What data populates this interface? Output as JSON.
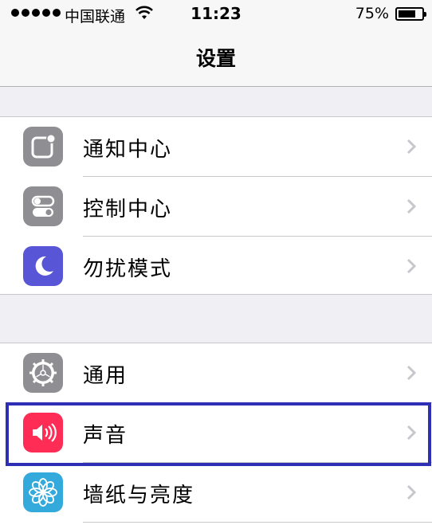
{
  "status_bar": {
    "carrier": "中国联通",
    "time": "11:23",
    "battery_percent": "75%",
    "battery_level": 0.75,
    "signal_bars": 5
  },
  "nav": {
    "title": "设置"
  },
  "groups": [
    {
      "items": [
        {
          "label": "通知中心",
          "icon": "notification-center-icon",
          "icon_color": "#8e8e93"
        },
        {
          "label": "控制中心",
          "icon": "control-center-icon",
          "icon_color": "#8e8e93"
        },
        {
          "label": "勿扰模式",
          "icon": "do-not-disturb-moon-icon",
          "icon_color": "#5856d6"
        }
      ]
    },
    {
      "items": [
        {
          "label": "通用",
          "icon": "general-gear-icon",
          "icon_color": "#8e8e93"
        },
        {
          "label": "声音",
          "icon": "sounds-speaker-icon",
          "icon_color": "#ff2d55",
          "highlighted": true
        },
        {
          "label": "墙纸与亮度",
          "icon": "wallpaper-flower-icon",
          "icon_color": "#34aadc"
        }
      ]
    }
  ],
  "colors": {
    "background": "#efeff4",
    "highlight_border": "#2f2fb6",
    "chevron": "#c7c7cc"
  }
}
